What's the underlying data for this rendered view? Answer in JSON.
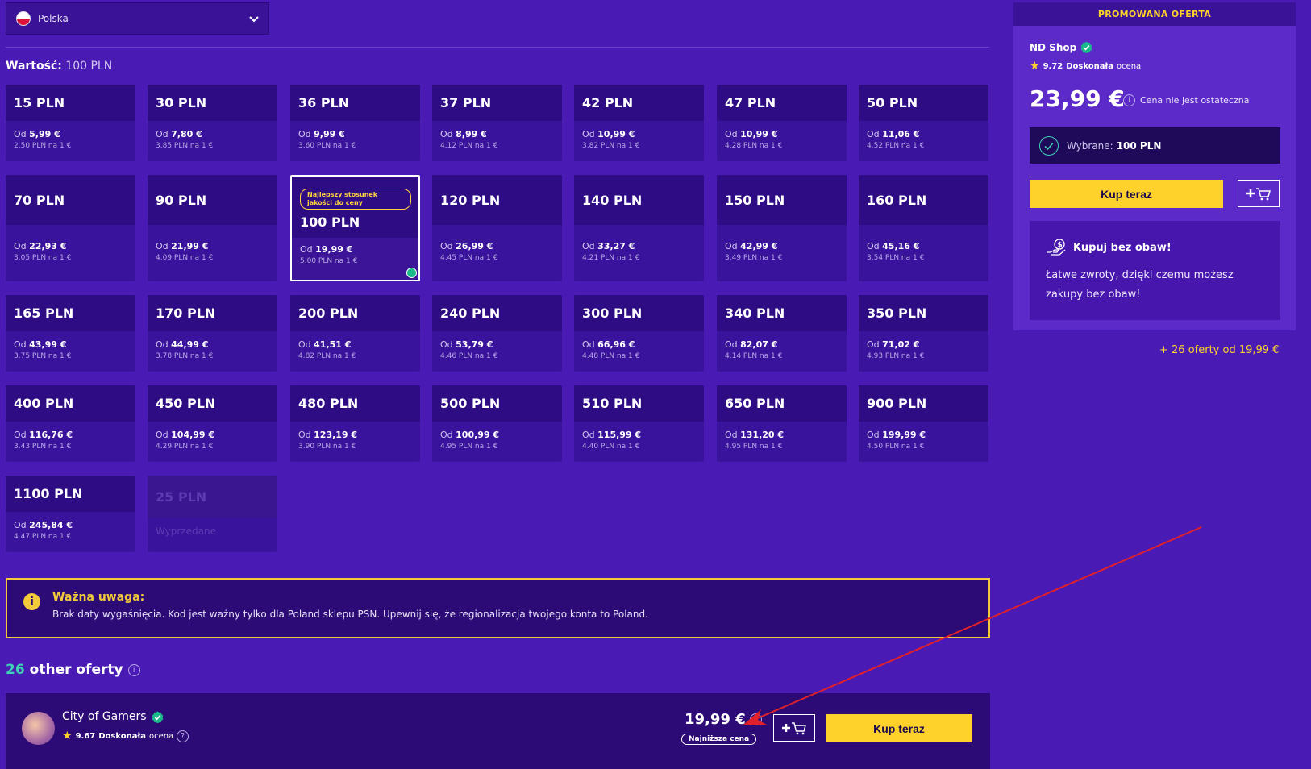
{
  "country": {
    "label": "Polska"
  },
  "value": {
    "label": "Wartość:",
    "amount": "100 PLN"
  },
  "tiles": [
    {
      "name": "15 PLN",
      "from": "Od",
      "price": "5,99 €",
      "rate": "2.50 PLN na 1 €"
    },
    {
      "name": "30 PLN",
      "from": "Od",
      "price": "7,80 €",
      "rate": "3.85 PLN na 1 €"
    },
    {
      "name": "36 PLN",
      "from": "Od",
      "price": "9,99 €",
      "rate": "3.60 PLN na 1 €"
    },
    {
      "name": "37 PLN",
      "from": "Od",
      "price": "8,99 €",
      "rate": "4.12 PLN na 1 €"
    },
    {
      "name": "42 PLN",
      "from": "Od",
      "price": "10,99 €",
      "rate": "3.82 PLN na 1 €"
    },
    {
      "name": "47 PLN",
      "from": "Od",
      "price": "10,99 €",
      "rate": "4.28 PLN na 1 €"
    },
    {
      "name": "50 PLN",
      "from": "Od",
      "price": "11,06 €",
      "rate": "4.52 PLN na 1 €"
    },
    {
      "name": "70 PLN",
      "from": "Od",
      "price": "22,93 €",
      "rate": "3.05 PLN na 1 €"
    },
    {
      "name": "90 PLN",
      "from": "Od",
      "price": "21,99 €",
      "rate": "4.09 PLN na 1 €"
    },
    {
      "name": "100 PLN",
      "from": "Od",
      "price": "19,99 €",
      "rate": "5.00 PLN na 1 €",
      "badge": "Najlepszy stosunek jakości do ceny"
    },
    {
      "name": "120 PLN",
      "from": "Od",
      "price": "26,99 €",
      "rate": "4.45 PLN na 1 €"
    },
    {
      "name": "140 PLN",
      "from": "Od",
      "price": "33,27 €",
      "rate": "4.21 PLN na 1 €"
    },
    {
      "name": "150 PLN",
      "from": "Od",
      "price": "42,99 €",
      "rate": "3.49 PLN na 1 €"
    },
    {
      "name": "160 PLN",
      "from": "Od",
      "price": "45,16 €",
      "rate": "3.54 PLN na 1 €"
    },
    {
      "name": "165 PLN",
      "from": "Od",
      "price": "43,99 €",
      "rate": "3.75 PLN na 1 €"
    },
    {
      "name": "170 PLN",
      "from": "Od",
      "price": "44,99 €",
      "rate": "3.78 PLN na 1 €"
    },
    {
      "name": "200 PLN",
      "from": "Od",
      "price": "41,51 €",
      "rate": "4.82 PLN na 1 €"
    },
    {
      "name": "240 PLN",
      "from": "Od",
      "price": "53,79 €",
      "rate": "4.46 PLN na 1 €"
    },
    {
      "name": "300 PLN",
      "from": "Od",
      "price": "66,96 €",
      "rate": "4.48 PLN na 1 €"
    },
    {
      "name": "340 PLN",
      "from": "Od",
      "price": "82,07 €",
      "rate": "4.14 PLN na 1 €"
    },
    {
      "name": "350 PLN",
      "from": "Od",
      "price": "71,02 €",
      "rate": "4.93 PLN na 1 €"
    },
    {
      "name": "400 PLN",
      "from": "Od",
      "price": "116,76 €",
      "rate": "3.43 PLN na 1 €"
    },
    {
      "name": "450 PLN",
      "from": "Od",
      "price": "104,99 €",
      "rate": "4.29 PLN na 1 €"
    },
    {
      "name": "480 PLN",
      "from": "Od",
      "price": "123,19 €",
      "rate": "3.90 PLN na 1 €"
    },
    {
      "name": "500 PLN",
      "from": "Od",
      "price": "100,99 €",
      "rate": "4.95 PLN na 1 €"
    },
    {
      "name": "510 PLN",
      "from": "Od",
      "price": "115,99 €",
      "rate": "4.40 PLN na 1 €"
    },
    {
      "name": "650 PLN",
      "from": "Od",
      "price": "131,20 €",
      "rate": "4.95 PLN na 1 €"
    },
    {
      "name": "900 PLN",
      "from": "Od",
      "price": "199,99 €",
      "rate": "4.50 PLN na 1 €"
    },
    {
      "name": "1100 PLN",
      "from": "Od",
      "price": "245,84 €",
      "rate": "4.47 PLN na 1 €"
    },
    {
      "name": "25 PLN",
      "soldout": "Wyprzedane"
    }
  ],
  "notice": {
    "title": "Ważna uwaga:",
    "text": "Brak daty wygaśnięcia. Kod jest ważny tylko dla Poland sklepu PSN. Upewnij się, że regionalizacja twojego konta to Poland."
  },
  "offers": {
    "count": "26",
    "label": "other oferty"
  },
  "seller": {
    "name": "City of Gamers",
    "score": "9.67",
    "score_word": "Doskonała",
    "score_suffix": "ocena",
    "price": "19,99 €",
    "badge": "Najniższa cena",
    "buy_label": "Kup teraz"
  },
  "promo": {
    "header": "PROMOWANA OFERTA",
    "shop": "ND Shop",
    "score": "9.72",
    "score_word": "Doskonała",
    "score_suffix": "ocena",
    "price": "23,99 €",
    "note": "Cena nie jest ostateczna",
    "selected_label": "Wybrane:",
    "selected_value": "100 PLN",
    "buy_label": "Kup teraz",
    "guarantee_title": "Kupuj bez obaw!",
    "guarantee_text": "Łatwe zwroty, dzięki czemu możesz zakupy bez obaw!",
    "more_offers": "+ 26 oferty od 19,99 €"
  },
  "colors": {
    "background": "#4a1ab5",
    "accent_yellow": "#fed22a",
    "accent_teal": "#3ed1b3",
    "tile": "#3a139c"
  }
}
